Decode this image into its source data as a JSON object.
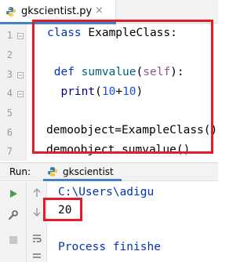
{
  "editor": {
    "tab": {
      "filename": "gkscientist.py",
      "close_glyph": "×",
      "icon": "python-file-icon"
    },
    "line_numbers": [
      "1",
      "2",
      "3",
      "4",
      "5",
      "6",
      "7"
    ],
    "code": {
      "l1_kw": "class",
      "l1_name": " ExampleClass:",
      "l3_indent": " ",
      "l3_kw": "def",
      "l3_fn": " sumvalue",
      "l3_open": "(",
      "l3_self": "self",
      "l3_close": "):",
      "l4_indent": "  ",
      "l4_builtin": "print",
      "l4_open": "(",
      "l4_num1": "10",
      "l4_op": "+",
      "l4_num2": "10",
      "l4_close": ")",
      "l6": "demoobject=ExampleClass()",
      "l7": "demoobject.sumvalue()"
    }
  },
  "run_window": {
    "label": "Run:",
    "config_name": "gkscientist",
    "output_lines": [
      "C:\\Users\\adigu",
      "20",
      "",
      "Process finishe"
    ]
  },
  "colors": {
    "highlight_box": "#e21d2b",
    "keyword": "#0033b3",
    "tab_accent": "#4083c9"
  }
}
